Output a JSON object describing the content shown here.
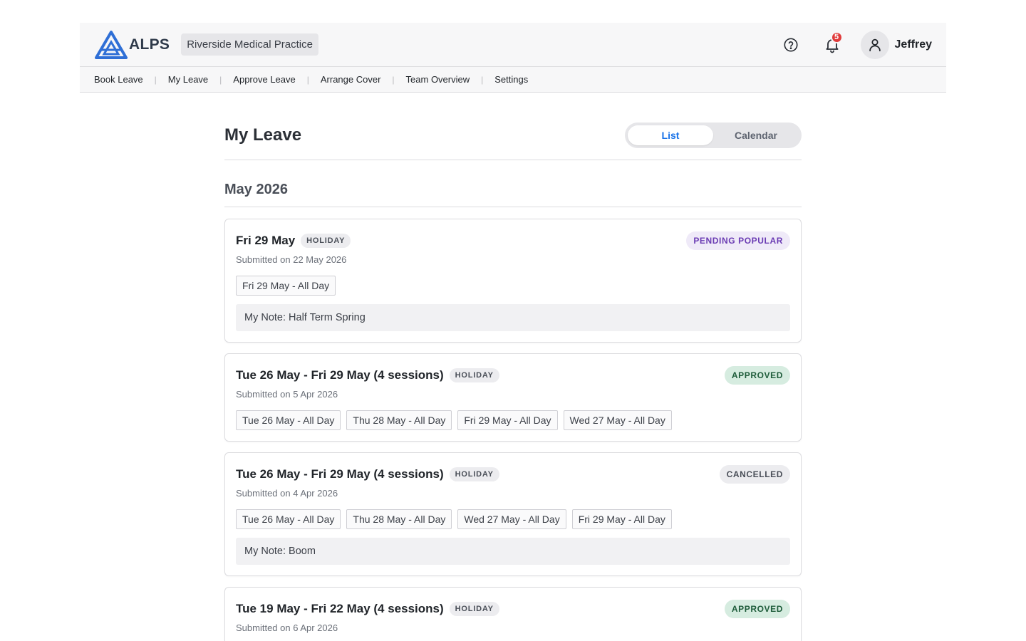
{
  "app": {
    "logo_text": "ALPS",
    "practice_name": "Riverside Medical Practice",
    "notification_count": "5",
    "user_name": "Jeffrey"
  },
  "nav": [
    "Book Leave",
    "My Leave",
    "Approve Leave",
    "Arrange Cover",
    "Team Overview",
    "Settings"
  ],
  "page": {
    "title": "My Leave",
    "view_toggle": {
      "list": "List",
      "calendar": "Calendar",
      "active": "List"
    }
  },
  "month_heading": "May 2026",
  "requests": [
    {
      "title": "Fri 29 May",
      "type": "HOLIDAY",
      "status": "PENDING POPULAR",
      "status_kind": "pending",
      "submitted": "Submitted on 22 May 2026",
      "sessions": [
        "Fri 29 May - All Day"
      ],
      "note": "My Note: Half Term Spring"
    },
    {
      "title": "Tue 26 May - Fri 29 May (4 sessions)",
      "type": "HOLIDAY",
      "status": "APPROVED",
      "status_kind": "approved",
      "submitted": "Submitted on 5 Apr 2026",
      "sessions": [
        "Tue 26 May - All Day",
        "Thu 28 May - All Day",
        "Fri 29 May - All Day",
        "Wed 27 May - All Day"
      ],
      "note": ""
    },
    {
      "title": "Tue 26 May - Fri 29 May (4 sessions)",
      "type": "HOLIDAY",
      "status": "CANCELLED",
      "status_kind": "cancelled",
      "submitted": "Submitted on 4 Apr 2026",
      "sessions": [
        "Tue 26 May - All Day",
        "Thu 28 May - All Day",
        "Wed 27 May - All Day",
        "Fri 29 May - All Day"
      ],
      "note": "My Note: Boom"
    },
    {
      "title": "Tue 19 May - Fri 22 May (4 sessions)",
      "type": "HOLIDAY",
      "status": "APPROVED",
      "status_kind": "approved",
      "submitted": "Submitted on 6 Apr 2026",
      "sessions": [],
      "note": ""
    }
  ],
  "colors": {
    "accent": "#1a73e8",
    "logo_blue": "#2f6fd6",
    "badge_red": "#e03b3b"
  }
}
